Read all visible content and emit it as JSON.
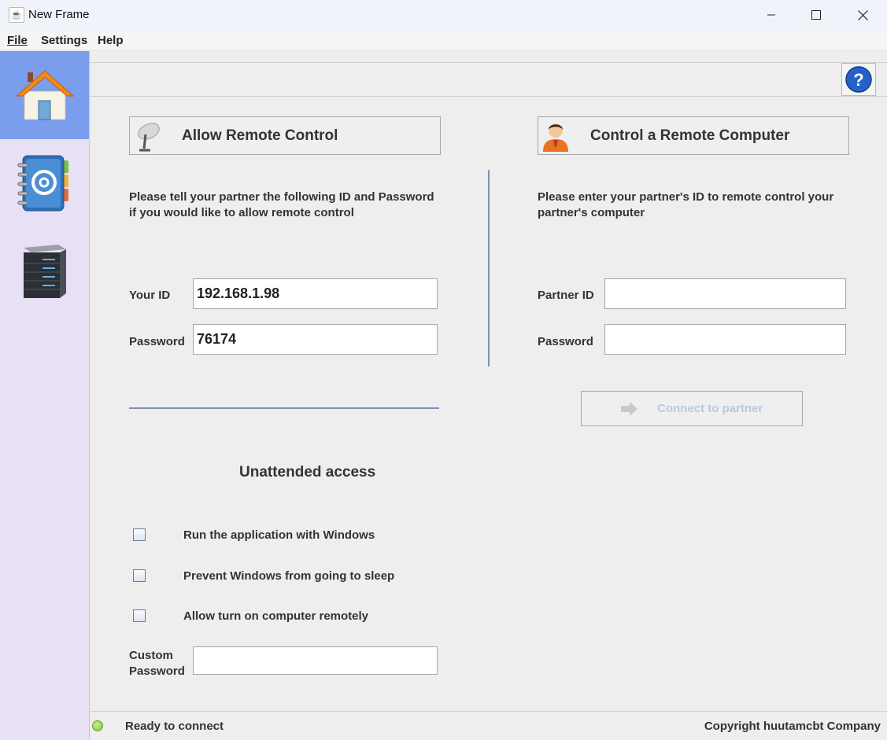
{
  "window": {
    "title": "New Frame"
  },
  "menu": {
    "items": [
      "File",
      "Settings",
      "Help"
    ]
  },
  "left_panel": {
    "title": "Allow Remote Control",
    "description_line1": "Please tell your partner the following ID and Password",
    "description_line2": "if you would like to allow remote control",
    "your_id_label": "Your ID",
    "your_id_value": "192.168.1.98",
    "password_label": "Password",
    "password_value": "76174"
  },
  "right_panel": {
    "title": "Control a Remote Computer",
    "description_line1": "Please enter your partner's ID to remote control your",
    "description_line2": "partner's computer",
    "partner_id_label": "Partner ID",
    "partner_id_value": "",
    "password_label": "Password",
    "password_value": "",
    "connect_label": "Connect to partner"
  },
  "unattended": {
    "title": "Unattended access",
    "options": [
      {
        "label": "Run the application with Windows",
        "checked": false
      },
      {
        "label": "Prevent Windows from going to sleep",
        "checked": false
      },
      {
        "label": "Allow turn on computer remotely",
        "checked": false
      }
    ],
    "custom_password_label_line1": "Custom",
    "custom_password_label_line2": "Password",
    "custom_password_value": ""
  },
  "status": {
    "text": "Ready to connect",
    "copyright": "Copyright huutamcbt Company",
    "indicator_color": "#7ac23c"
  },
  "sidebar": {
    "items": [
      {
        "icon": "home-icon",
        "active": true
      },
      {
        "icon": "address-book-icon",
        "active": false
      },
      {
        "icon": "server-icon",
        "active": false
      }
    ]
  },
  "colors": {
    "sidebar_bg": "#e8e1f6",
    "sidebar_active": "#7b9ded",
    "separator": "#7f8fb7"
  }
}
